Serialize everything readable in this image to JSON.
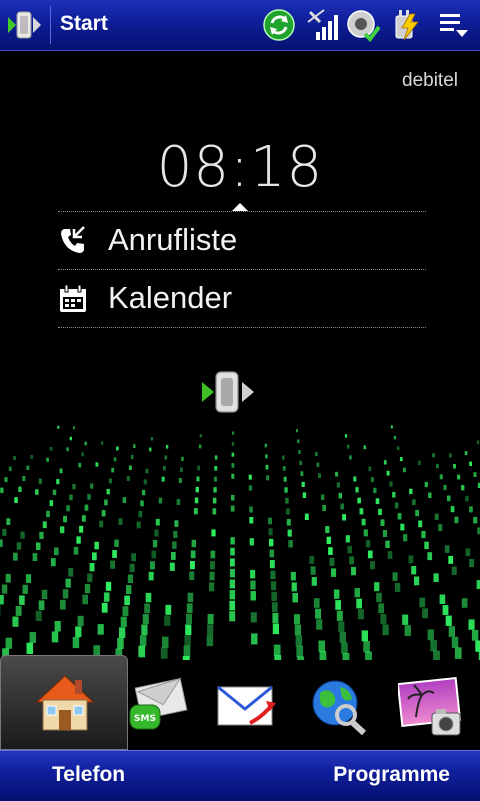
{
  "status_bar": {
    "start_label": "Start",
    "icons": [
      "sync-icon",
      "signal-icon",
      "speaker-icon",
      "battery-charging-icon",
      "menu-icon"
    ]
  },
  "home": {
    "operator": "debitel",
    "time": "08:18",
    "items": [
      {
        "label": "Anrufliste",
        "icon": "call-log-icon"
      },
      {
        "label": "Kalender",
        "icon": "calendar-icon"
      }
    ]
  },
  "dock": {
    "items": [
      "home-icon",
      "sms-icon",
      "email-icon",
      "internet-icon",
      "photos-icon"
    ],
    "sms_badge": "SMS",
    "active_index": 0
  },
  "softkeys": {
    "left": "Telefon",
    "right": "Programme"
  },
  "colors": {
    "bar_blue": "#0e1e98",
    "matrix_green": "#33ff66"
  }
}
